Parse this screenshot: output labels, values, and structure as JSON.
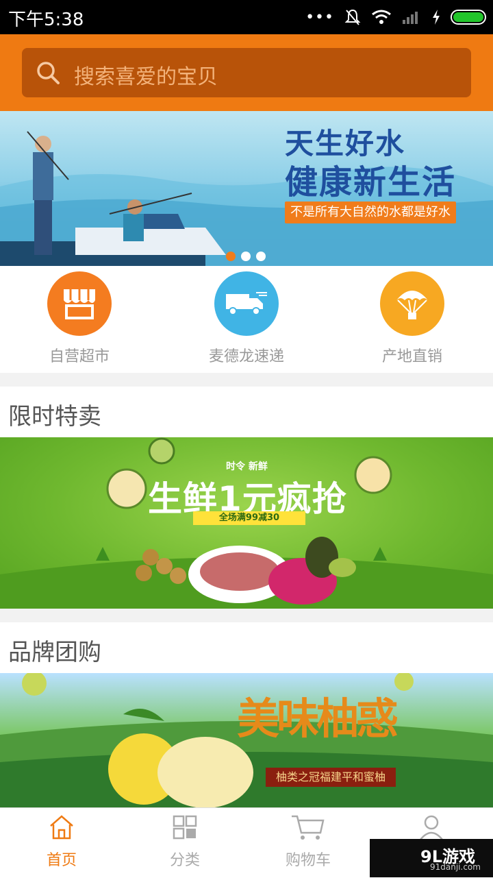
{
  "status_bar": {
    "time": "下午5:38"
  },
  "search": {
    "placeholder": "搜索喜爱的宝贝"
  },
  "banner": {
    "title_line1": "天生好水",
    "title_line2": "健康新生活",
    "tagline": "不是所有大自然的水都是好水",
    "pager": {
      "count": 3,
      "active": 1
    }
  },
  "quick_links": [
    {
      "label": "自营超市",
      "icon": "store-icon",
      "color": "#f47c20"
    },
    {
      "label": "麦德龙速递",
      "icon": "delivery-truck-icon",
      "color": "#40b4e5"
    },
    {
      "label": "产地直销",
      "icon": "parachute-icon",
      "color": "#f7a822"
    }
  ],
  "sections": {
    "flash_sale": {
      "title": "限时特卖",
      "banner_small": "时令  新鲜",
      "banner_headline": "生鲜1元疯抢",
      "banner_ribbon": "全场满99减30"
    },
    "brand_group": {
      "title": "品牌团购",
      "banner_headline": "美味柚惑",
      "banner_caption": "柚类之冠福建平和蜜柚"
    }
  },
  "tabbar": {
    "items": [
      {
        "label": "首页",
        "icon": "home-icon",
        "active": true
      },
      {
        "label": "分类",
        "icon": "grid-icon",
        "active": false
      },
      {
        "label": "购物车",
        "icon": "cart-icon",
        "active": false
      },
      {
        "label": "",
        "icon": "user-icon",
        "active": false
      }
    ]
  },
  "watermark": {
    "main": "9L游戏",
    "sub": "91danji.com"
  },
  "colors": {
    "accent": "#ef7a12",
    "search_bg": "#b85309"
  }
}
